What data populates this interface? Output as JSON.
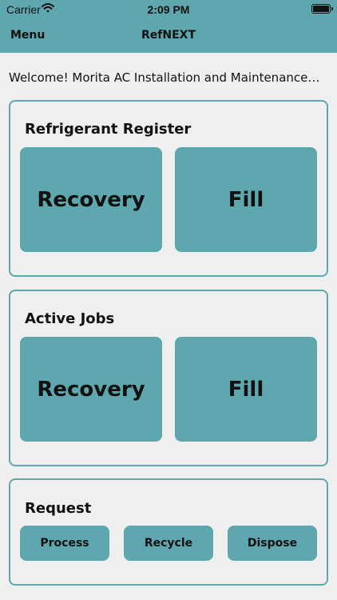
{
  "status_bar": {
    "carrier": "Carrier",
    "time": "2:09 PM"
  },
  "nav": {
    "menu_label": "Menu",
    "title": "RefNEXT"
  },
  "welcome_text": "Welcome! Morita AC Installation and Maintenance…",
  "sections": {
    "register": {
      "title": "Refrigerant Register",
      "recovery_label": "Recovery",
      "fill_label": "Fill"
    },
    "active_jobs": {
      "title": "Active Jobs",
      "recovery_label": "Recovery",
      "fill_label": "Fill"
    },
    "request": {
      "title": "Request",
      "process_label": "Process",
      "recycle_label": "Recycle",
      "dispose_label": "Dispose"
    }
  },
  "colors": {
    "accent": "#5fa7ae",
    "background": "#efefef"
  }
}
